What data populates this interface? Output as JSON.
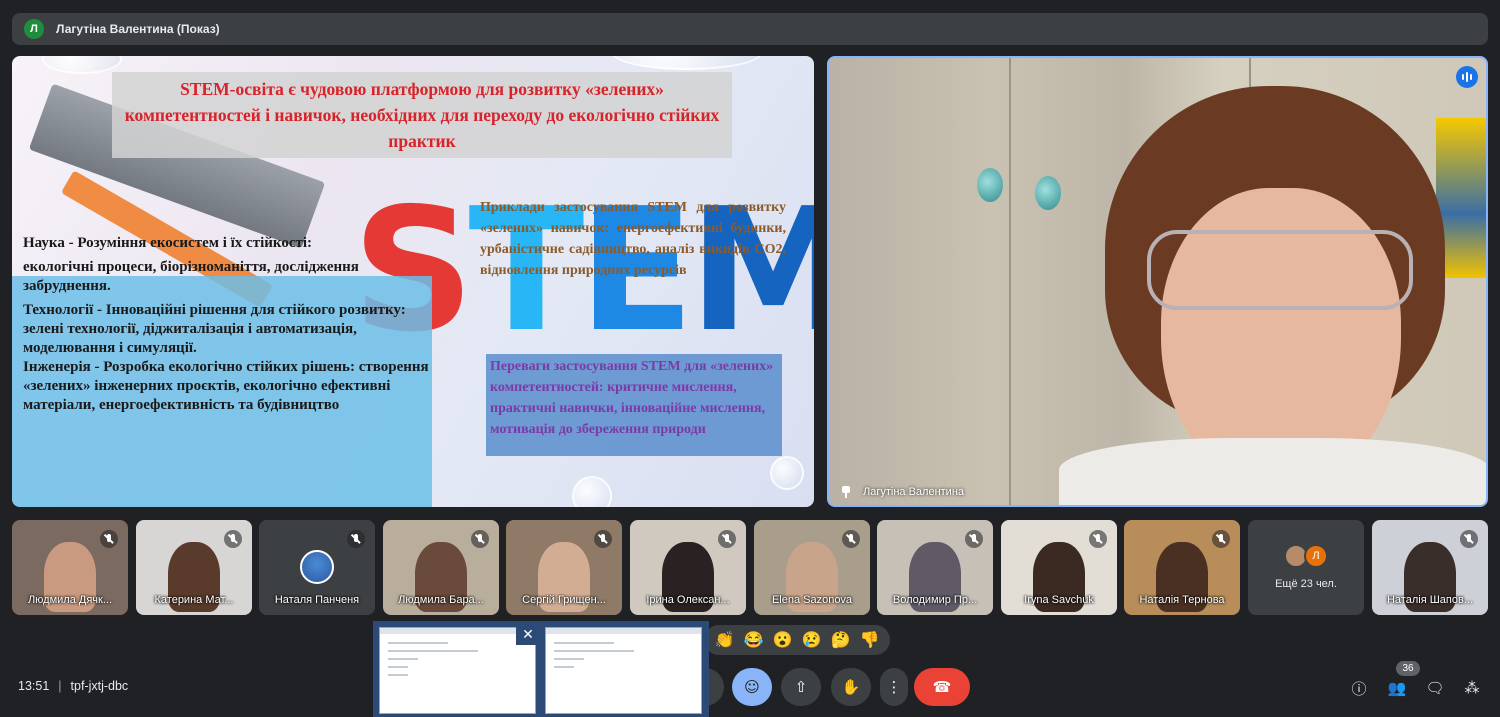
{
  "topbar": {
    "avatar_letter": "Л",
    "presenter_label": "Лагутіна Валентина (Показ)"
  },
  "slide": {
    "title": "STEM-освіта є чудовою платформою для розвитку «зелених» компетентностей і навичок, необхідних для переходу до екологічно стійких практик",
    "left_paragraphs": [
      "Наука - Розуміння екосистем і їх стійкості:",
      "екологічні процеси, біорізноманіття, дослідження забруднення.",
      "Технології - Інноваційні рішення для стійкого розвитку:",
      "зелені технології, діджиталізація і автоматизація, моделювання і симуляції.",
      "Інженерія - Розробка екологічно стійких рішень: створення «зелених» інженерних проєктів, екологічно ефективні матеріали, енергоефективність та будівництво"
    ],
    "examples_text": "Приклади застосування STEM для розвитку «зелених» навичок: енергоефективні будинки, урбаністичне садівництво, аналіз викидів CO2, відновлення природних ресурсів",
    "advantages_text": "Переваги застосування STEM для «зелених» компетентностей: критичне мислення, практичні навички, інноваційне мислення, мотивація до збереження природи",
    "stem_letters": [
      "S",
      "T",
      "E",
      "M"
    ]
  },
  "speaker": {
    "name": "Лагутіна Валентина"
  },
  "participants": [
    {
      "name": "Людмила Дячк...",
      "bg": "#7b6a60",
      "skin": "#c99a80"
    },
    {
      "name": "Катерина Мат...",
      "bg": "#d8d6d4",
      "skin": "#5a3a2a"
    },
    {
      "name": "Наталя Панченя",
      "bg": "#3c4043",
      "skin": ""
    },
    {
      "name": "Людмила Бара...",
      "bg": "#b9ad9c",
      "skin": "#6a4a3a"
    },
    {
      "name": "Сергій Грищен...",
      "bg": "#8e7a66",
      "skin": "#d2ad94"
    },
    {
      "name": "Ірина Олексан...",
      "bg": "#cfc9c0",
      "skin": "#2a2222"
    },
    {
      "name": "Elena Sazonova",
      "bg": "#a99e8c",
      "skin": "#c8a48a"
    },
    {
      "name": "Володимир Пр...",
      "bg": "#c7c0b7",
      "skin": "#5f5a66"
    },
    {
      "name": "Iryna Savchuk",
      "bg": "#e2ded6",
      "skin": "#3a2a22"
    },
    {
      "name": "Наталія Тернова",
      "bg": "#b88d5a",
      "skin": "#4a3022"
    },
    {
      "name": "more",
      "bg": "#3c4043",
      "skin": ""
    },
    {
      "name": "Наталія Шапов...",
      "bg": "#cdd0d6",
      "skin": "#3a2e2a"
    }
  ],
  "more_tile": {
    "label": "Ещё 23 чел.",
    "avatar_letter": "Л"
  },
  "reactions": [
    "👏",
    "😂",
    "😮",
    "😢",
    "🤔",
    "👎"
  ],
  "meeting": {
    "time": "13:51",
    "separator": "|",
    "code": "tpf-jxtj-dbc"
  },
  "controls": {
    "emoji_icon": "☺",
    "present_icon": "⇧",
    "hand_icon": "✋",
    "more_icon": "⋮",
    "hangup_icon": "☎"
  },
  "right_toolbar": {
    "info_icon": "ⓘ",
    "people_icon": "👥",
    "people_count": "36",
    "chat_icon": "🗨",
    "activities_icon": "⁂"
  },
  "taskbar": {
    "close_icon": "✕"
  },
  "colors": {
    "background": "#202124",
    "title_red": "#d8232a",
    "advantages_purple": "#7b3aa8",
    "examples_brown": "#8a5a2a",
    "hangup_red": "#ea4335",
    "active_blue": "#8ab4f8"
  }
}
